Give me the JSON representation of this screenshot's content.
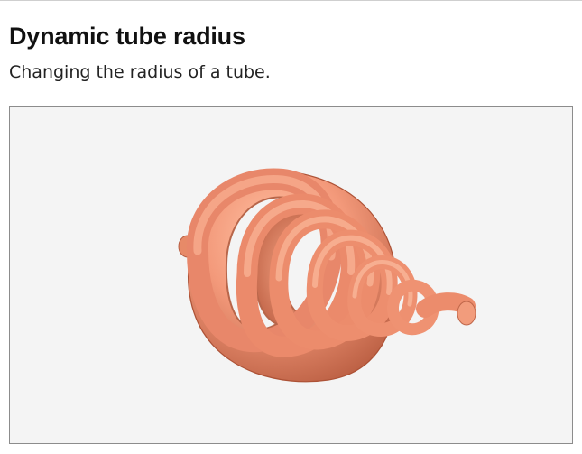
{
  "page": {
    "title": "Dynamic tube radius",
    "subtitle": "Changing the radius of a tube."
  },
  "scene": {
    "background_color": "#f4f4f4",
    "tube_color": "#ee8f6c",
    "border_color": "#8c8c8c"
  }
}
